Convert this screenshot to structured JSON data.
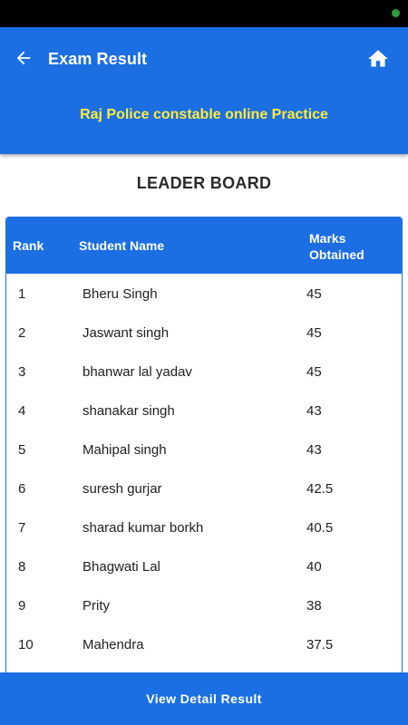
{
  "header": {
    "title": "Exam Result",
    "subtitle": "Raj Police constable online Practice",
    "back_icon": "arrow-back-icon",
    "home_icon": "home-icon"
  },
  "leaderboard": {
    "title": "LEADER BOARD",
    "columns": {
      "rank": "Rank",
      "name": "Student Name",
      "marks_line1": "Marks",
      "marks_line2": "Obtained"
    },
    "rows": [
      {
        "rank": "1",
        "name": "Bheru Singh",
        "marks": "45"
      },
      {
        "rank": "2",
        "name": "Jaswant singh",
        "marks": "45"
      },
      {
        "rank": "3",
        "name": "bhanwar lal yadav",
        "marks": "45"
      },
      {
        "rank": "4",
        "name": "shanakar singh",
        "marks": "43"
      },
      {
        "rank": "5",
        "name": "Mahipal singh",
        "marks": "43"
      },
      {
        "rank": "6",
        "name": "suresh gurjar",
        "marks": "42.5"
      },
      {
        "rank": "7",
        "name": "sharad kumar borkh",
        "marks": "40.5"
      },
      {
        "rank": "8",
        "name": "Bhagwati Lal",
        "marks": "40"
      },
      {
        "rank": "9",
        "name": "Prity",
        "marks": "38"
      },
      {
        "rank": "10",
        "name": "Mahendra",
        "marks": "37.5"
      }
    ]
  },
  "footer": {
    "button_label": "View Detail Result"
  },
  "colors": {
    "primary": "#1c6ee3",
    "subtitle": "#ffeb3b",
    "status_bar": "#000000"
  }
}
